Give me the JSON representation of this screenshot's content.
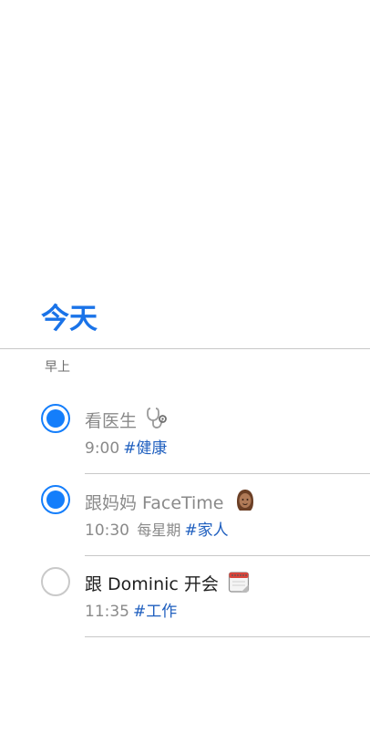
{
  "header": {
    "title": "今天"
  },
  "section": {
    "label": "早上"
  },
  "tasks": [
    {
      "title": "看医生",
      "emoji_icon": "stethoscope-icon",
      "time": "9:00",
      "repeat": "",
      "tag": "#健康",
      "completed": true
    },
    {
      "title": "跟妈妈 FaceTime",
      "emoji_icon": "woman-face-icon",
      "time": "10:30",
      "repeat": "每星期",
      "tag": "#家人",
      "completed": true
    },
    {
      "title": "跟 Dominic 开会",
      "emoji_icon": "calendar-icon",
      "time": "11:35",
      "repeat": "",
      "tag": "#工作",
      "completed": false
    }
  ],
  "colors": {
    "accent": "#147efb",
    "title": "#1a73e8",
    "tag": "#1f5fbf",
    "muted": "#8a8a8a",
    "divider": "#c8c8c8"
  }
}
